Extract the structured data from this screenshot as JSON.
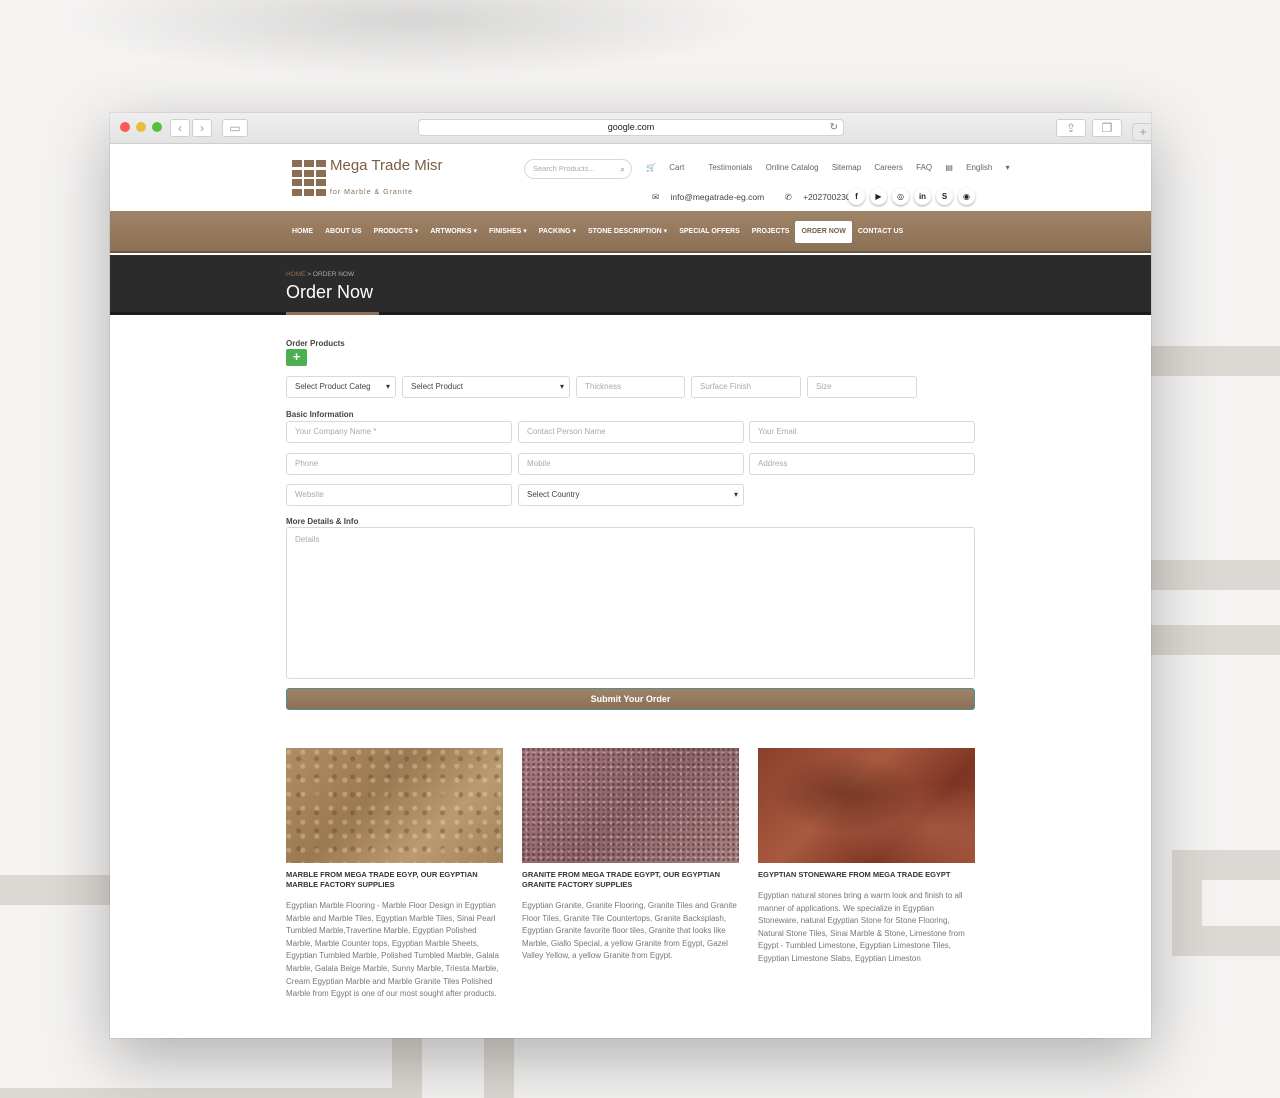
{
  "browser": {
    "url": "google.com"
  },
  "site": {
    "logo_title": "Mega Trade Misr",
    "logo_sub": "for Marble & Granite",
    "search_placeholder": "Search Products...",
    "top_links": [
      "Cart",
      "Testimonials",
      "Online Catalog",
      "Sitemap",
      "Careers",
      "FAQ",
      "English"
    ],
    "email": "info@megatrade-eg.com",
    "phone": "+2027002300",
    "social": [
      "f",
      "▶",
      "◎",
      "in",
      "S",
      "◉"
    ],
    "accent_color": "#8c7055"
  },
  "nav": {
    "items": [
      "HOME",
      "ABOUT US",
      "PRODUCTS ▾",
      "ARTWORKS ▾",
      "FINISHES ▾",
      "PACKING ▾",
      "STONE DESCRIPTION ▾",
      "SPECIAL OFFERS",
      "PROJECTS",
      "ORDER NOW",
      "CONTACT US"
    ],
    "active_index": 9
  },
  "page": {
    "breadcrumb_home": "HOME",
    "breadcrumb_sep": ">",
    "breadcrumb_current": "ORDER NOW",
    "title": "Order Now"
  },
  "form": {
    "order_products_label": "Order Products",
    "add_label": "+",
    "product_category": "Select Product Categ",
    "product": "Select Product",
    "thickness_placeholder": "Thickness",
    "surface_finish_placeholder": "Surface Finish",
    "size_placeholder": "Size",
    "basic_info_label": "Basic Information",
    "company_placeholder": "Your Company Name *",
    "contact_person_placeholder": "Contact Person Name",
    "email_placeholder": "Your Email",
    "phone_placeholder": "Phone",
    "mobile_placeholder": "Mobile",
    "address_placeholder": "Address",
    "website_placeholder": "Website",
    "country": "Select Country",
    "more_details_label": "More Details & Info",
    "details_placeholder": "Details",
    "submit_label": "Submit Your Order"
  },
  "cards": [
    {
      "title": "MARBLE FROM MEGA TRADE EGYP, OUR EGYPTIAN MARBLE FACTORY SUPPLIES",
      "text": "Egyptian Marble Flooring - Marble Floor Design in Egyptian Marble and Marble Tiles, Egyptian Marble Tiles, Sinai Pearl Tumbled Marble,Travertine Marble, Egyptian Polished Marble, Marble Counter tops, Egyptian Marble Sheets, Egyptian Tumbled Marble, Polished Tumbled Marble, Galala Marble, Galala Beige Marble, Sunny Marble, Triesta Marble, Cream Egyptian Marble and Marble Granite Tiles Polished Marble from Egypt is one of our most sought after products."
    },
    {
      "title": "GRANITE FROM MEGA TRADE EGYPT, OUR EGYPTIAN GRANITE FACTORY SUPPLIES",
      "text": "Egyptian Granite, Granite Flooring, Granite Tiles and Granite Floor Tiles, Granite Tile Countertops, Granite Backsplash, Egyptian Granite favorite floor tiles, Granite that looks like Marble, Giallo Special, a yellow Granite from Egypt, Gazel Valley Yellow, a yellow Granite from Egypt."
    },
    {
      "title": "EGYPTIAN STONEWARE FROM MEGA TRADE EGYPT",
      "text": "Egyptian natural stones bring a warm look and finish to all manner of applications. We specialize in Egyptian Stoneware, natural Egyptian Stone for Stone Flooring, Natural Stone Tiles, Sinai Marble & Stone, Limestone from Egypt - Tumbled Limestone, Egyptian Limestone Tiles, Egyptian Limestone Slabs, Egyptian Limeston"
    }
  ]
}
